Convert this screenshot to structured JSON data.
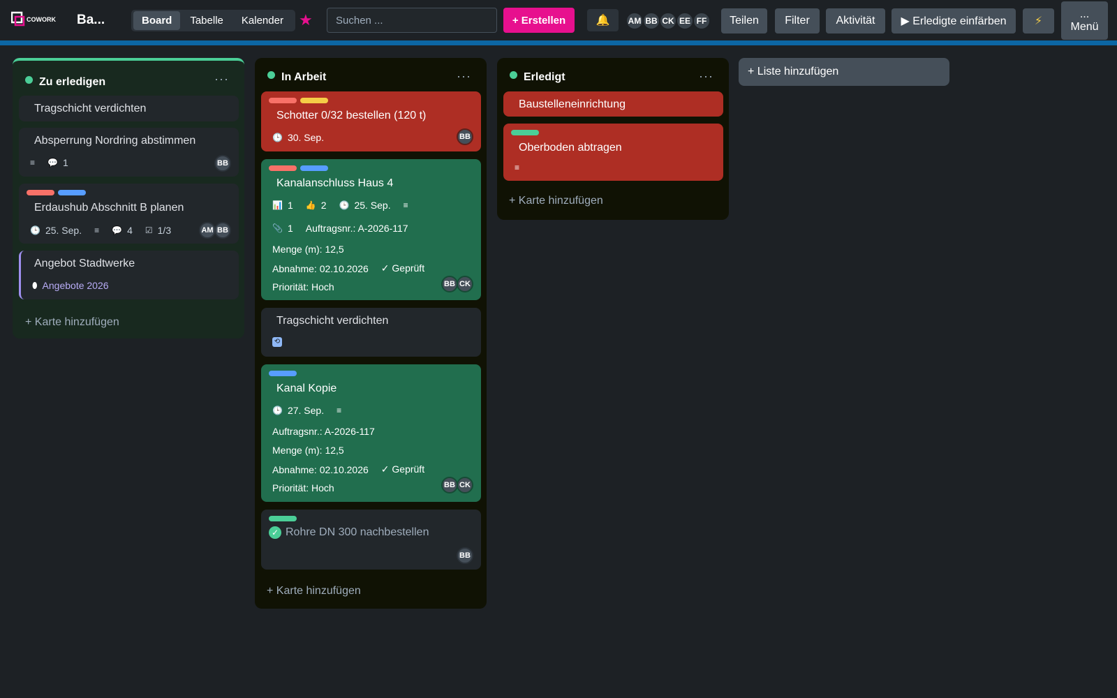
{
  "header": {
    "logo_text": "COWORK",
    "board_title": "Ba...",
    "views": [
      "Board",
      "Tabelle",
      "Kalender"
    ],
    "active_view": "Board",
    "search_placeholder": "Suchen ...",
    "create_label": "+ Erstellen",
    "members": [
      "AM",
      "BB",
      "CK",
      "EE",
      "FF"
    ],
    "share_label": "Teilen",
    "filter_label": "Filter",
    "activity_label": "Aktivität",
    "color_done_label": "▶ Erledigte einfärben",
    "menu_dots": "...",
    "menu_label": "Menü"
  },
  "colors": {
    "brand": "#e7108e",
    "list_dot": "#4bce97",
    "label_red": "#f87168",
    "label_yellow": "#f5cd47",
    "label_blue": "#579dff",
    "label_green": "#4bce97",
    "label_purple": "#9f8fef",
    "card_red": "#ae2e24",
    "card_green": "#216e4e"
  },
  "lists": {
    "todo": {
      "title": "Zu erledigen",
      "add_card": "+ Karte hinzufügen",
      "cards": [
        {
          "title": "Tragschicht verdichten"
        },
        {
          "title": "Absperrung Nordring abstimmen",
          "comments": "1",
          "members": [
            "BB"
          ]
        },
        {
          "title": "Erdaushub Abschnitt B planen",
          "due": "25. Sep.",
          "comments": "4",
          "checklist": "1/3",
          "members": [
            "AM",
            "BB"
          ]
        },
        {
          "title": "Angebot Stadtwerke",
          "tag": "Angebote 2026"
        }
      ]
    },
    "doing": {
      "title": "In Arbeit",
      "add_card": "+ Karte hinzufügen",
      "cards": [
        {
          "title": "Schotter 0/32 bestellen (120 t)",
          "due": "30. Sep.",
          "members": [
            "BB"
          ]
        },
        {
          "title": "Kanalanschluss Haus 4",
          "poll": "1",
          "votes": "2",
          "due": "25. Sep.",
          "attachments": "1",
          "order_no": "Auftragsnr.: A-2026-117",
          "quantity": "Menge (m): 12,5",
          "acceptance": "Abnahme: 02.10.2026",
          "checked": "✓ Geprüft",
          "priority": "Priorität: Hoch",
          "members": [
            "BB",
            "CK"
          ]
        },
        {
          "title": "Tragschicht verdichten"
        },
        {
          "title": "Kanal Kopie",
          "due": "27. Sep.",
          "order_no": "Auftragsnr.: A-2026-117",
          "quantity": "Menge (m): 12,5",
          "acceptance": "Abnahme: 02.10.2026",
          "checked": "✓ Geprüft",
          "priority": "Priorität: Hoch",
          "members": [
            "BB",
            "CK"
          ]
        },
        {
          "title": "Rohre DN 300 nachbestellen",
          "members": [
            "BB"
          ]
        }
      ]
    },
    "done": {
      "title": "Erledigt",
      "add_card": "+ Karte hinzufügen",
      "cards": [
        {
          "title": "Baustelleneinrichtung"
        },
        {
          "title": "Oberboden abtragen"
        }
      ]
    }
  },
  "add_list": "+ Liste hinzufügen"
}
